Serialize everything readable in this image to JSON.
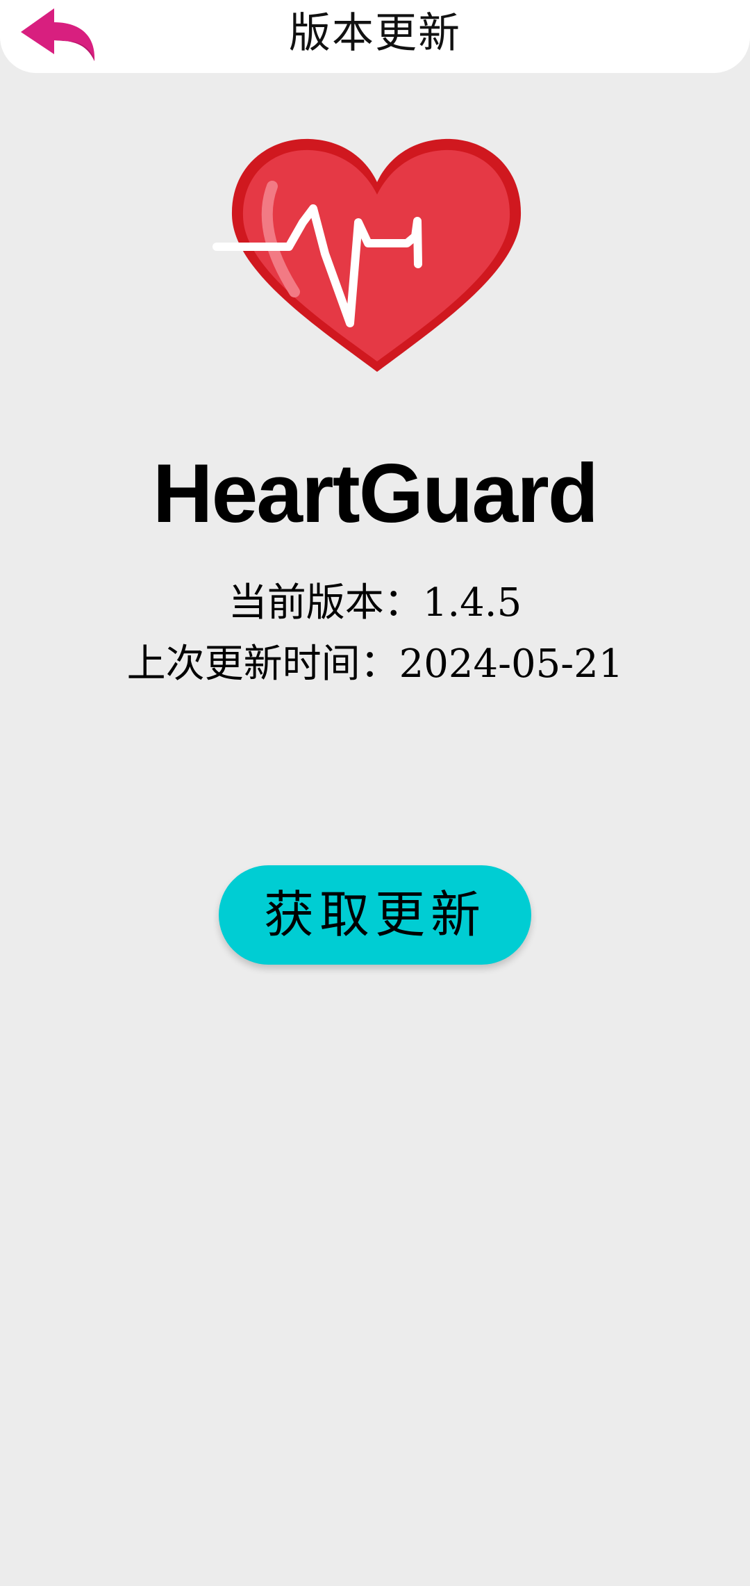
{
  "header": {
    "title": "版本更新",
    "back_icon": "back-arrow-icon"
  },
  "app": {
    "name": "HeartGuard",
    "logo_icon": "heart-pulse-icon"
  },
  "version_info": {
    "current_version": "当前版本：1.4.5",
    "last_update": "上次更新时间：2024-05-21"
  },
  "actions": {
    "update_label": "获取更新"
  },
  "colors": {
    "background": "#ececec",
    "header": "#ffffff",
    "accent_button": "#00cdd3",
    "back_icon": "#d81f7f",
    "heart": "#e53945",
    "heart_dark": "#d0181f"
  }
}
